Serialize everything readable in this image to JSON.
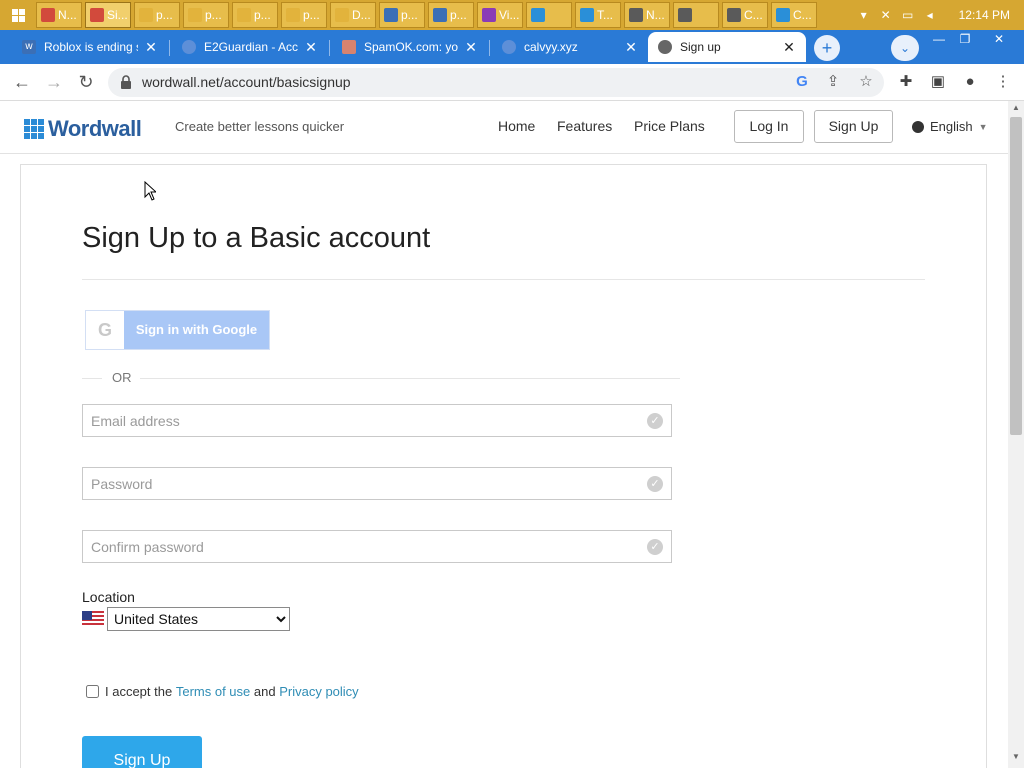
{
  "taskbar": {
    "items": [
      {
        "label": "N...",
        "icon": "chrome-icon",
        "color": "#d24a3c"
      },
      {
        "label": "Si...",
        "icon": "chrome-icon",
        "color": "#d24a3c"
      },
      {
        "label": "p...",
        "icon": "folder-icon",
        "color": "#e2b33c"
      },
      {
        "label": "p...",
        "icon": "folder-icon",
        "color": "#e2b33c"
      },
      {
        "label": "p...",
        "icon": "folder-icon",
        "color": "#e2b33c"
      },
      {
        "label": "p...",
        "icon": "folder-icon",
        "color": "#e2b33c"
      },
      {
        "label": "D...",
        "icon": "download-folder-icon",
        "color": "#e2b33c"
      },
      {
        "label": "p...",
        "icon": "window-icon",
        "color": "#3b6fb6"
      },
      {
        "label": "p...",
        "icon": "image-editor-icon",
        "color": "#3b6fb6"
      },
      {
        "label": "Vi...",
        "icon": "visual-studio-icon",
        "color": "#8a3bb6"
      },
      {
        "label": "",
        "icon": "internet-explorer-icon",
        "color": "#2a8fd8"
      },
      {
        "label": "T...",
        "icon": "internet-explorer-icon",
        "color": "#2a8fd8"
      },
      {
        "label": "N...",
        "icon": "notes-icon",
        "color": "#5a5a5a"
      },
      {
        "label": "",
        "icon": "notes-icon",
        "color": "#5a5a5a"
      },
      {
        "label": "C...",
        "icon": "notes-icon",
        "color": "#5a5a5a"
      },
      {
        "label": "C...",
        "icon": "palette-icon",
        "color": "#2a8fd8"
      }
    ],
    "clock": "12:14 PM"
  },
  "tabs": [
    {
      "title": "Roblox is ending s",
      "favicon": "wordwall-favicon",
      "active": false
    },
    {
      "title": "E2Guardian - Acc",
      "favicon": "globe-icon",
      "active": false
    },
    {
      "title": "SpamOK.com: yo",
      "favicon": "spamok-favicon",
      "active": false
    },
    {
      "title": "calvyy.xyz",
      "favicon": "globe-icon",
      "active": false
    },
    {
      "title": "Sign up",
      "favicon": "globe-icon",
      "active": true
    }
  ],
  "toolbar": {
    "url": "wordwall.net/account/basicsignup"
  },
  "site": {
    "brand": "Wordwall",
    "tagline": "Create better lessons quicker",
    "nav": {
      "home": "Home",
      "features": "Features",
      "pricing": "Price Plans"
    },
    "login": "Log In",
    "signup": "Sign Up",
    "language": "English"
  },
  "form": {
    "title": "Sign Up to a Basic account",
    "google_button": "Sign in with Google",
    "or": "OR",
    "email_placeholder": "Email address",
    "password_placeholder": "Password",
    "confirm_placeholder": "Confirm password",
    "location_label": "Location",
    "location_value": "United States",
    "terms_prefix": "I accept the",
    "terms_link": "Terms of use",
    "terms_and": "and",
    "privacy_link": "Privacy policy",
    "submit": "Sign Up"
  },
  "colors": {
    "taskbar": "#d6a732",
    "tabstrip": "#2a7ad6",
    "brand_blue": "#2b5f9e",
    "google_button": "#a9c7f6",
    "primary_button": "#2ea7ea",
    "link": "#2f8db5"
  }
}
